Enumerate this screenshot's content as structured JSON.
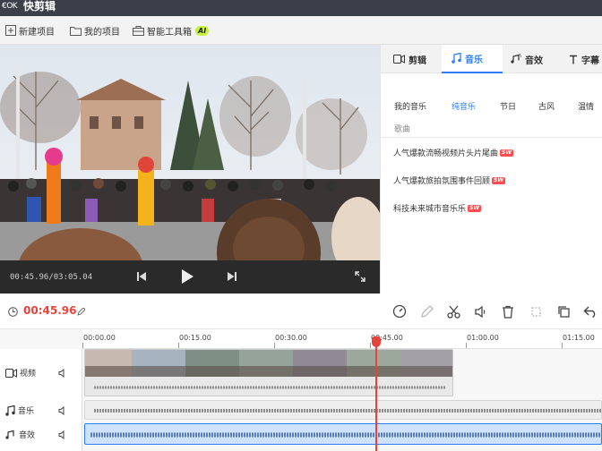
{
  "app": {
    "logo_text": "€OK",
    "title": "快剪辑"
  },
  "toolbar": {
    "new_project": "新建项目",
    "my_projects": "我的项目",
    "smart_toolbox": "智能工具箱",
    "ai_badge": "AI"
  },
  "player": {
    "timecode": "00:45.96/03:05.04"
  },
  "side_panel": {
    "tabs": [
      {
        "label": "剪辑",
        "icon": "video-icon",
        "active": false
      },
      {
        "label": "音乐",
        "icon": "music-note-icon",
        "active": true
      },
      {
        "label": "音效",
        "icon": "sound-effect-icon",
        "active": false
      },
      {
        "label": "字幕",
        "icon": "text-icon",
        "active": false
      }
    ],
    "categories": [
      "我的音乐",
      "纯音乐",
      "节日",
      "古风",
      "温情"
    ],
    "active_category": "纯音乐",
    "sub_header": "歌曲",
    "tracks": [
      {
        "title": "人气爆款流畅视频片头片尾曲",
        "badge": "SW"
      },
      {
        "title": "人气爆款旅拍氛围事件回顾",
        "badge": "SW"
      },
      {
        "title": "科技未来城市音乐乐",
        "badge": "SW"
      }
    ]
  },
  "edit_bar": {
    "current_time": "00:45.96",
    "tools": [
      "speed-icon",
      "pen-icon",
      "scissors-icon",
      "volume-icon",
      "delete-icon",
      "magic-icon",
      "copy-icon",
      "undo-icon"
    ]
  },
  "timeline": {
    "ruler_labels": [
      "00:00.00",
      "00:15.00",
      "00:30.00",
      "00:45.00",
      "01:00.00",
      "01:15.00"
    ],
    "tracks": [
      {
        "label": "视频",
        "icon": "film-icon"
      },
      {
        "label": "音乐",
        "icon": "music-note-icon"
      },
      {
        "label": "音效",
        "icon": "sound-effect-icon"
      }
    ],
    "playhead_time": "00:45.96"
  },
  "colors": {
    "accent": "#2e7df6",
    "playhead": "#e8433a",
    "titlebar": "#3a3f4a"
  }
}
